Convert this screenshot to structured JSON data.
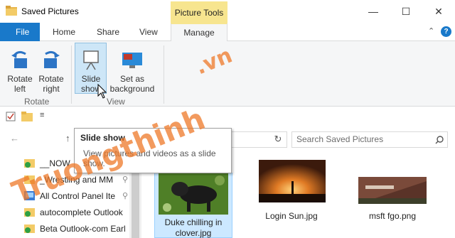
{
  "window": {
    "title": "Saved Pictures",
    "context_tab": "Picture Tools"
  },
  "tabs": {
    "file": "File",
    "home": "Home",
    "share": "Share",
    "view": "View",
    "manage": "Manage"
  },
  "ribbon": {
    "rotate_left": [
      "Rotate",
      "left"
    ],
    "rotate_right": [
      "Rotate",
      "right"
    ],
    "slide_show": [
      "Slide",
      "show"
    ],
    "set_background": [
      "Set as",
      "background"
    ],
    "group_rotate": "Rotate",
    "group_view": "View"
  },
  "tooltip": {
    "title": "Slide show",
    "body": "View pictures and videos as a slide show."
  },
  "search": {
    "placeholder": "Search Saved Pictures"
  },
  "nav_items": [
    {
      "label": "__NOW",
      "icon": "check-folder-icon",
      "pinned": false
    },
    {
      "label": "_Wrestling and MM",
      "icon": "folder-icon",
      "pinned": true
    },
    {
      "label": "All Control Panel Ite",
      "icon": "control-panel-icon",
      "pinned": true
    },
    {
      "label": "autocomplete Outlook",
      "icon": "check-folder-icon",
      "pinned": false
    },
    {
      "label": "Beta Outlook-com Earl",
      "icon": "check-folder-icon",
      "pinned": false
    }
  ],
  "files": [
    {
      "name": "Duke chilling in clover.jpg",
      "line1": "Duke chilling in",
      "line2": "clover.jpg",
      "selected": true
    },
    {
      "name": "Login Sun.jpg",
      "line1": "Login Sun.jpg",
      "line2": "",
      "selected": false
    },
    {
      "name": "msft fgo.png",
      "line1": "msft fgo.png",
      "line2": "",
      "selected": false
    }
  ],
  "watermark": {
    "text": "Truongthinh",
    "suffix": ".vn"
  },
  "colors": {
    "accent": "#1979ca",
    "context": "#f7e58f",
    "selection": "#cce8ff"
  }
}
